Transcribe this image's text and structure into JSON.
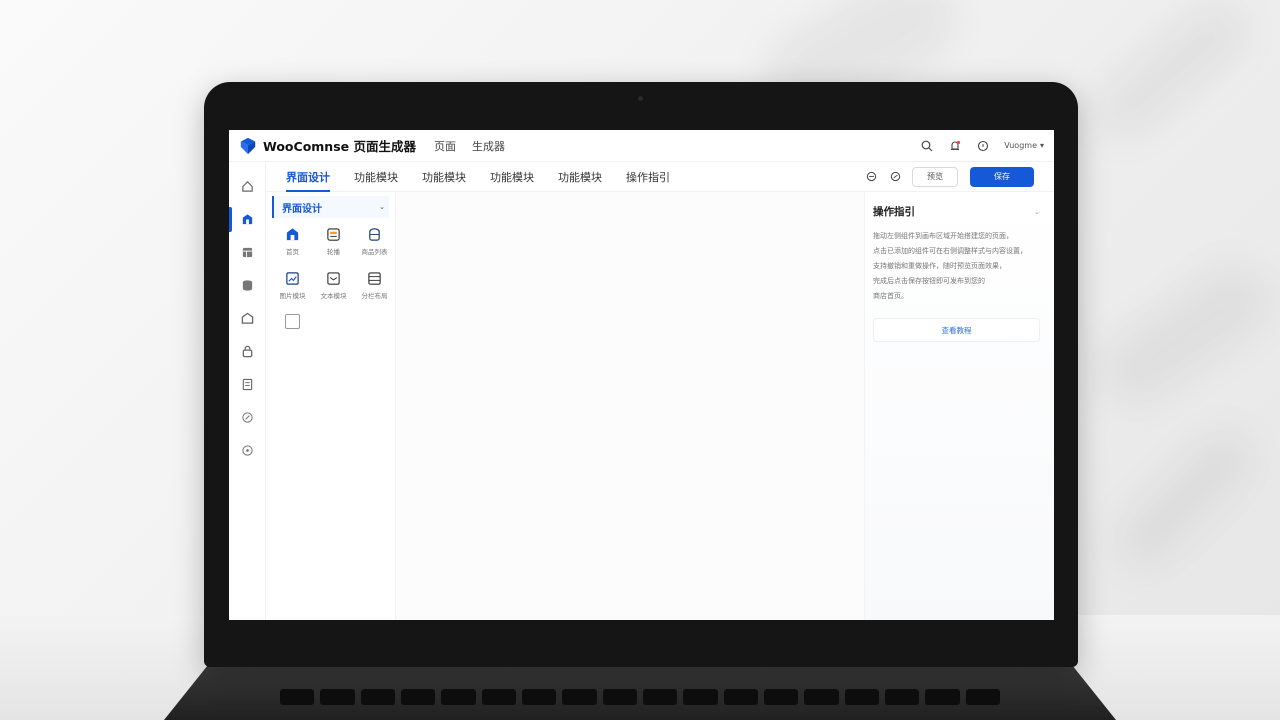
{
  "app": {
    "title": "WooComnse 页面生成器"
  },
  "header": {
    "links": [
      "页面",
      "生成器"
    ],
    "user_label": "Vuogme"
  },
  "rail": {
    "items": [
      "home",
      "builder",
      "layout",
      "database",
      "shop",
      "lock",
      "document",
      "compass",
      "target"
    ]
  },
  "tabs": [
    "界面设计",
    "功能模块",
    "功能模块",
    "功能模块",
    "功能模块",
    "操作指引"
  ],
  "actions": {
    "secondary_label": "预览",
    "primary_label": "保存"
  },
  "panel": {
    "title": "界面设计",
    "components": [
      {
        "label": "首页",
        "icon": "home-block-icon"
      },
      {
        "label": "轮播",
        "icon": "carousel-icon"
      },
      {
        "label": "商品列表",
        "icon": "product-list-icon"
      },
      {
        "label": "图片模块",
        "icon": "image-block-icon"
      },
      {
        "label": "文本模块",
        "icon": "text-block-icon"
      },
      {
        "label": "分栏布局",
        "icon": "columns-icon"
      },
      {
        "label": "",
        "icon": "blank-block-icon"
      }
    ]
  },
  "guide": {
    "title": "操作指引",
    "lines": [
      "拖动左侧组件到画布区域开始搭建您的页面，",
      "点击已添加的组件可在右侧调整样式与内容设置，",
      "支持撤销和重做操作，随时预览页面效果，",
      "完成后点击保存按钮即可发布到您的",
      "商店首页。"
    ],
    "button_label": "查看教程"
  },
  "colors": {
    "accent": "#1559d9"
  }
}
